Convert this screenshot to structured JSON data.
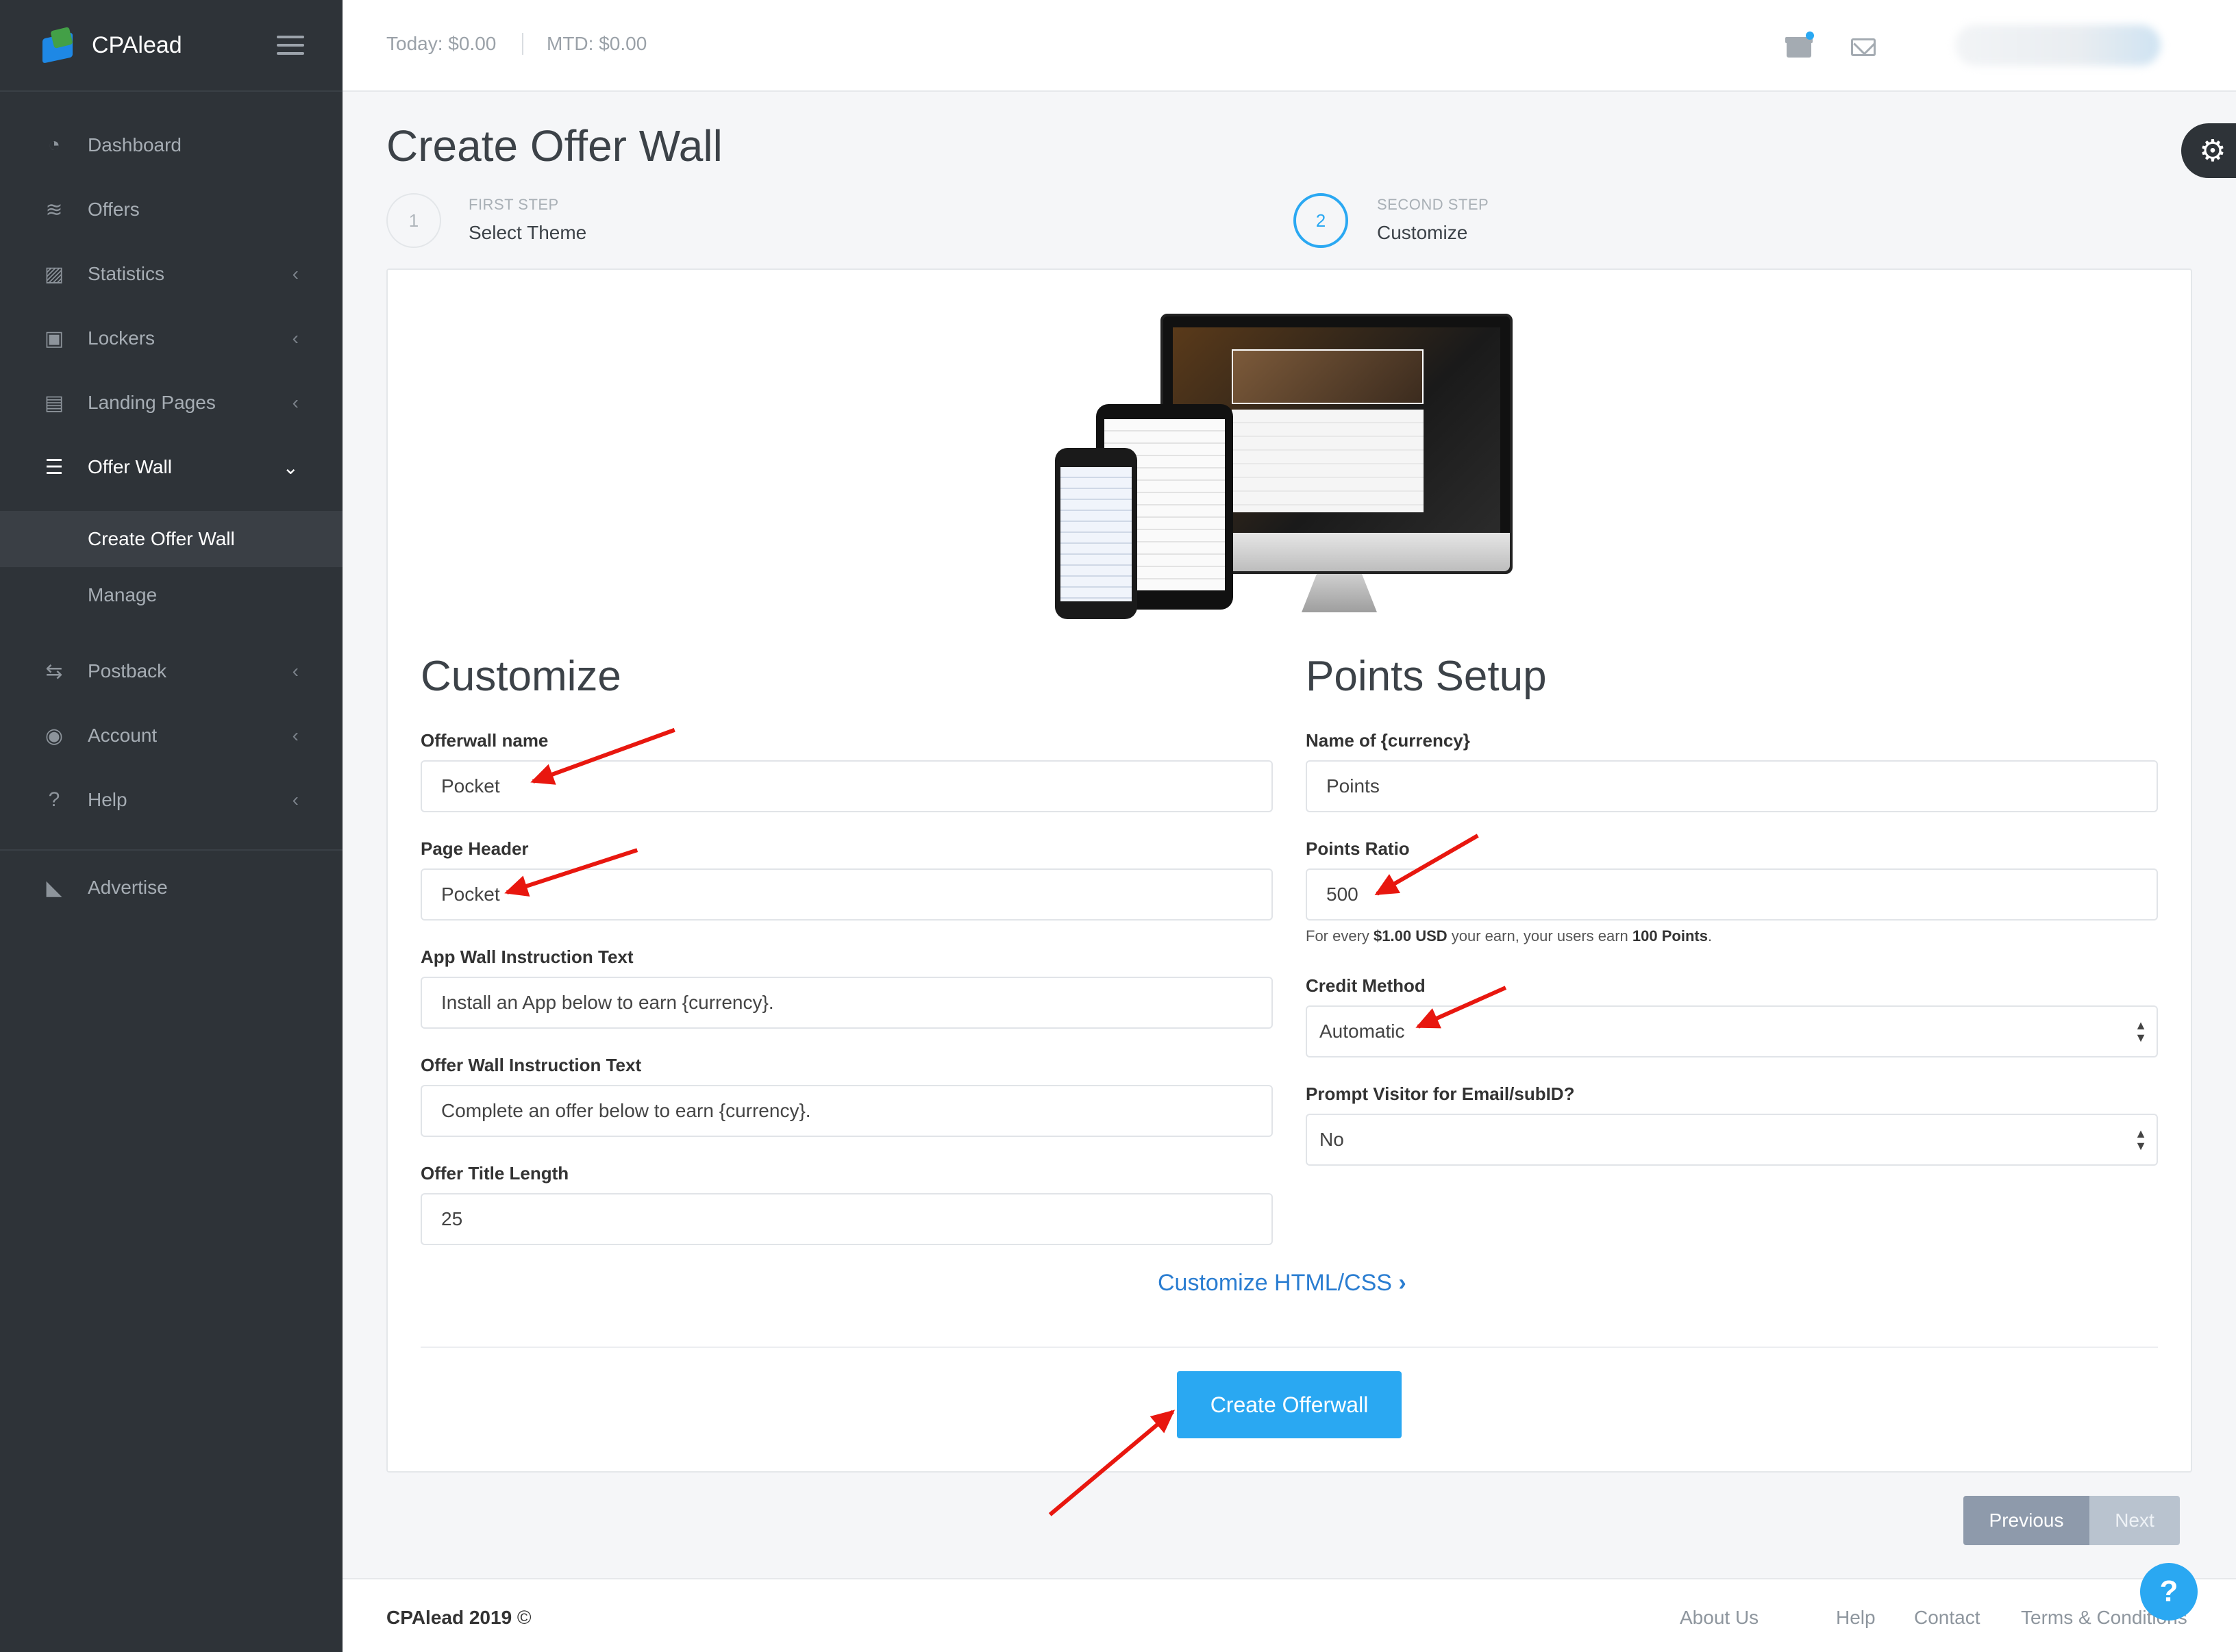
{
  "app": {
    "name": "CPAlead"
  },
  "topbar": {
    "today": "Today: $0.00",
    "mtd": "MTD: $0.00"
  },
  "sidebar": {
    "items": [
      {
        "label": "Dashboard",
        "icon": "dashboard-icon"
      },
      {
        "label": "Offers",
        "icon": "layers-icon"
      },
      {
        "label": "Statistics",
        "icon": "chart-icon"
      },
      {
        "label": "Lockers",
        "icon": "lock-icon"
      },
      {
        "label": "Landing Pages",
        "icon": "newspaper-icon"
      },
      {
        "label": "Offer Wall",
        "icon": "list-icon"
      },
      {
        "label": "Postback",
        "icon": "postback-icon"
      },
      {
        "label": "Account",
        "icon": "user-circle-icon"
      },
      {
        "label": "Help",
        "icon": "question-circle-icon"
      },
      {
        "label": "Advertise",
        "icon": "megaphone-icon"
      }
    ],
    "offerwall_sub": [
      "Create Offer Wall",
      "Manage"
    ]
  },
  "page": {
    "title": "Create Offer Wall"
  },
  "steps": [
    {
      "number": "1",
      "label": "FIRST STEP",
      "name": "Select Theme"
    },
    {
      "number": "2",
      "label": "SECOND STEP",
      "name": "Customize"
    }
  ],
  "customize": {
    "title": "Customize",
    "fields": [
      {
        "label": "Offerwall name",
        "value": "Pocket"
      },
      {
        "label": "Page Header",
        "value": "Pocket"
      },
      {
        "label": "App Wall Instruction Text",
        "value": "Install an App below to earn {currency}."
      },
      {
        "label": "Offer Wall Instruction Text",
        "value": "Complete an offer below to earn {currency}."
      },
      {
        "label": "Offer Title Length",
        "value": "25"
      }
    ]
  },
  "points": {
    "title": "Points Setup",
    "currency_label": "Name of {currency}",
    "currency_value": "Points",
    "ratio_label": "Points Ratio",
    "ratio_value": "500",
    "help_pre": "For every ",
    "help_amount": "$1.00 USD",
    "help_mid": " your earn, your users earn ",
    "help_points": "100 Points",
    "help_post": ".",
    "credit_label": "Credit Method",
    "credit_value": "Automatic",
    "prompt_label": "Prompt Visitor for Email/subID?",
    "prompt_value": "No"
  },
  "actions": {
    "customize_link": "Customize HTML/CSS",
    "create": "Create Offerwall",
    "previous": "Previous",
    "next": "Next"
  },
  "footer": {
    "brand": "CPAlead 2019",
    "copy_sym": "©",
    "links": [
      "About Us",
      "Help",
      "Contact",
      "Terms & Conditions"
    ]
  },
  "colors": {
    "accent": "#2aa8f2",
    "sidebar": "#2e3338",
    "annotation": "#e8170f"
  }
}
